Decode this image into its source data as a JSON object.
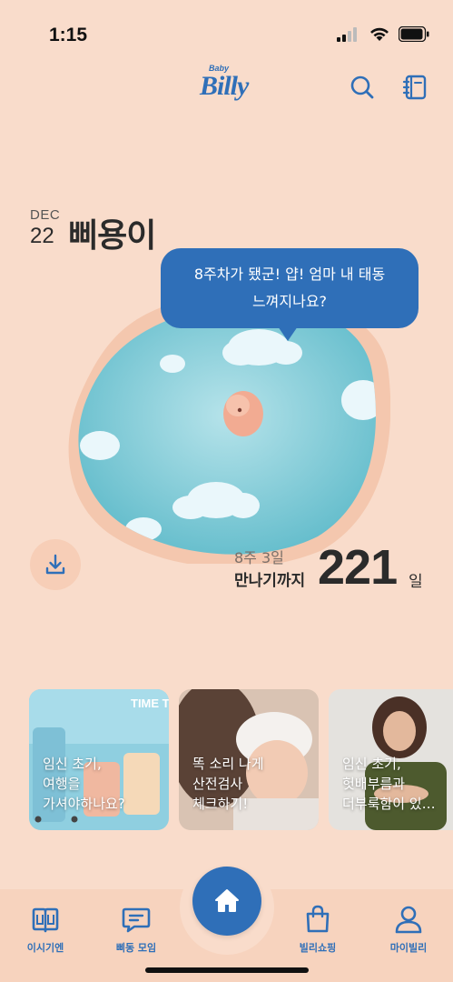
{
  "status_bar": {
    "time": "1:15"
  },
  "header": {
    "logo_small": "Baby",
    "logo_main": "Billy"
  },
  "baby": {
    "month": "DEC",
    "day": "22",
    "name": "삐용이",
    "speech_line1": "8주차가 됐군! 얍! 엄마 내 태동",
    "speech_line2": "느껴지나요?",
    "weeks": "8주 3일",
    "dday_label": "만나기까지",
    "dday_count": "221",
    "dday_unit": "일"
  },
  "cards": [
    {
      "line1": "임신 초기,",
      "line2": "여행을",
      "line3": "가셔야하나요?",
      "image_text": "TIME T"
    },
    {
      "line1": "똑 소리 나게",
      "line2": "산전검사",
      "line3": "체크하기!"
    },
    {
      "line1": "임신 초기,",
      "line2": "헛배부름과",
      "line3": "더부룩함이 있…"
    }
  ],
  "tabs": [
    {
      "label": "이시기엔",
      "icon": "book-icon"
    },
    {
      "label": "삐동 모임",
      "icon": "chat-icon"
    },
    {
      "label": "",
      "icon": "home-icon"
    },
    {
      "label": "빌리쇼핑",
      "icon": "shopping-bag-icon"
    },
    {
      "label": "마이빌리",
      "icon": "person-icon"
    }
  ],
  "colors": {
    "accent": "#2f6fb8",
    "background": "#f9dccb",
    "tab_bg": "#f7d3be"
  }
}
